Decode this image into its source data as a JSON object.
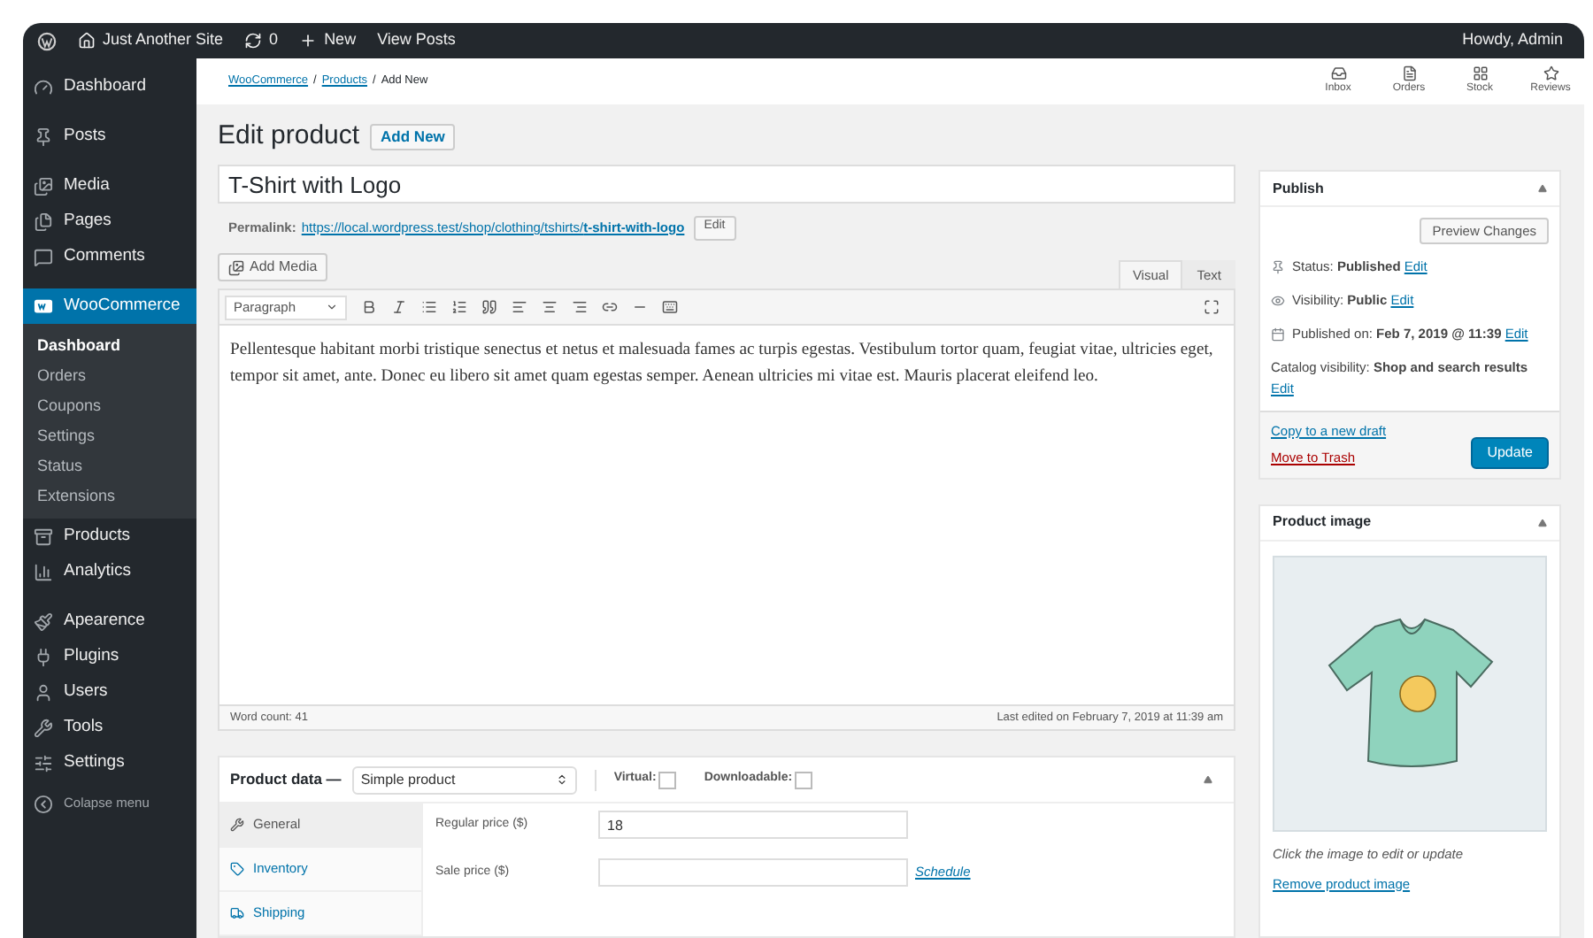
{
  "admin_bar": {
    "site": "Just Another Site",
    "updates": "0",
    "new": "New",
    "view": "View Posts",
    "greeting": "Howdy, Admin"
  },
  "sidebar": {
    "items": [
      {
        "label": "Dashboard",
        "selected": false
      },
      {
        "label": "Posts",
        "selected": false
      },
      {
        "label": "Media",
        "selected": false
      },
      {
        "label": "Pages",
        "selected": false
      },
      {
        "label": "Comments",
        "selected": false
      },
      {
        "label": "WooCommerce",
        "selected": true,
        "children": [
          {
            "label": "Dashboard",
            "selected": true
          },
          {
            "label": "Orders",
            "selected": false
          },
          {
            "label": "Coupons",
            "selected": false
          },
          {
            "label": "Settings",
            "selected": false
          },
          {
            "label": "Status",
            "selected": false
          },
          {
            "label": "Extensions",
            "selected": false
          }
        ]
      },
      {
        "label": "Products",
        "selected": false
      },
      {
        "label": "Analytics",
        "selected": false
      },
      {
        "label": "Apearence",
        "selected": false
      },
      {
        "label": "Plugins",
        "selected": false
      },
      {
        "label": "Users",
        "selected": false
      },
      {
        "label": "Tools",
        "selected": false
      },
      {
        "label": "Settings",
        "selected": false
      }
    ],
    "collapse": "Colapse menu"
  },
  "breadcrumb": [
    {
      "label": "WooCommerce",
      "kind": "link"
    },
    {
      "label": "/",
      "kind": "text"
    },
    {
      "label": "Products",
      "kind": "link"
    },
    {
      "label": "/",
      "kind": "text"
    },
    {
      "label": "Add New",
      "kind": "text"
    }
  ],
  "activity": [
    "Inbox",
    "Orders",
    "Stock",
    "Reviews"
  ],
  "page_title": "Edit product",
  "add_new": "Add New",
  "title_field": {
    "value": "T-Shirt with Logo"
  },
  "permalink": {
    "label": "Permalink:",
    "url": "https://local.wordpress.test/shop/clothing/tshirts/**t-shirt-with-logo**",
    "button": "Edit"
  },
  "editor": {
    "add_media": "Add Media",
    "tabs": [
      {
        "label": "Visual",
        "selected": true
      },
      {
        "label": "Text",
        "selected": false
      }
    ],
    "format": "Paragraph",
    "content": "Pellentesque habitant morbi tristique senectus et netus et malesuada fames ac turpis egestas. Vestibulum tortor quam, feugiat vitae, ultricies eget, tempor sit amet, ante. Donec eu libero sit amet quam egestas semper. Aenean ultricies mi vitae est. Mauris placerat eleifend leo.",
    "word_count": "Word count: 41",
    "last_edited": "Last edited on February 7, 2019 at 11:39 am"
  },
  "product_data": {
    "title": "Product data —",
    "type": "Simple product",
    "options": [
      {
        "label": "Virtual:",
        "checked": false
      },
      {
        "label": "Downloadable:",
        "checked": false
      }
    ],
    "tabs": [
      {
        "label": "General",
        "selected": true
      },
      {
        "label": "Inventory",
        "selected": false
      },
      {
        "label": "Shipping",
        "selected": false
      }
    ],
    "fields": [
      {
        "label": "Regular price ($)",
        "value": "18"
      },
      {
        "label": "Sale price ($)",
        "link": "Schedule"
      }
    ]
  },
  "publish": {
    "title": "Publish",
    "preview": "Preview Changes",
    "rows": [
      {
        "text": "Status: **Published**",
        "link": "Edit"
      },
      {
        "text": "Visibility: **Public**",
        "link": "Edit"
      },
      {
        "text": "Published on: **Feb 7, 2019 @ 11:39**",
        "link": "Edit"
      },
      {
        "text": "Catalog visibility: **Shop and search results**",
        "link": "Edit"
      }
    ],
    "copy": "Copy to a new draft",
    "trash": "Move to Trash",
    "update": "Update"
  },
  "product_image": {
    "title": "Product image",
    "hint": "Click the image to edit or update",
    "remove": "Remove product image"
  }
}
